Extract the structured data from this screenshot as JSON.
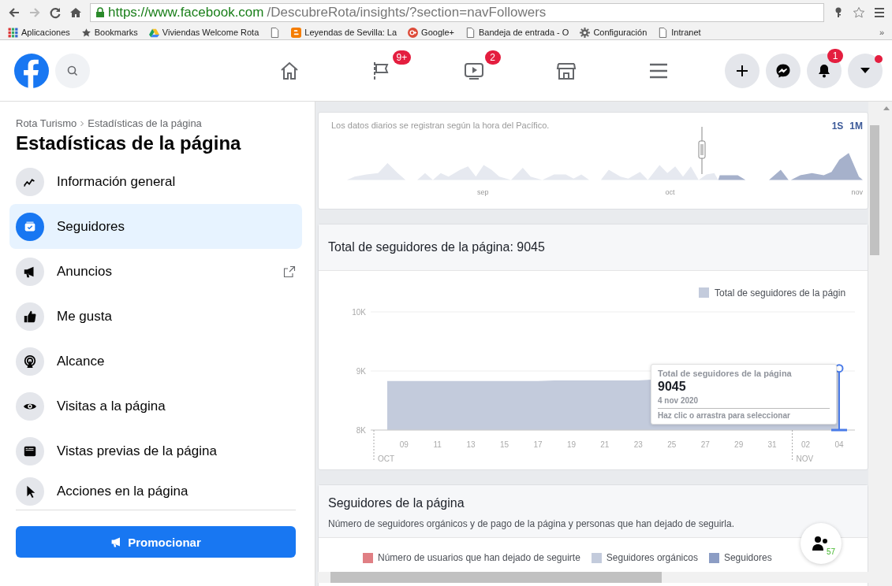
{
  "browser": {
    "url_host": "https://www.facebook.com",
    "url_path": "/DescubreRota/insights/?section=navFollowers",
    "bookmarks": [
      {
        "kind": "apps",
        "label": "Aplicaciones"
      },
      {
        "kind": "star",
        "label": "Bookmarks"
      },
      {
        "kind": "drive",
        "label": "Viviendas Welcome Rota"
      },
      {
        "kind": "page"
      },
      {
        "kind": "blogger",
        "label": "Leyendas de Sevilla: La"
      },
      {
        "kind": "google",
        "label": "Google+"
      },
      {
        "kind": "page",
        "label": "Bandeja de entrada - O"
      },
      {
        "kind": "gear",
        "label": "Configuración"
      },
      {
        "kind": "page",
        "label": "Intranet"
      }
    ],
    "more": "»"
  },
  "nav": {
    "tabs": [
      {
        "kind": "home"
      },
      {
        "kind": "flag",
        "badge": "9+"
      },
      {
        "kind": "video",
        "badge": "2"
      },
      {
        "kind": "store"
      },
      {
        "kind": "menu"
      }
    ],
    "actions": [
      {
        "kind": "plus"
      },
      {
        "kind": "messenger"
      },
      {
        "kind": "bell",
        "badge": "1"
      },
      {
        "kind": "caret",
        "alert": true
      }
    ]
  },
  "sidebar": {
    "breadcrumb": [
      "Rota Turismo",
      "Estadísticas de la página"
    ],
    "title": "Estadísticas de la página",
    "items": [
      {
        "kind": "trend",
        "label": "Información general",
        "selected": false
      },
      {
        "kind": "followers",
        "label": "Seguidores",
        "selected": true
      },
      {
        "kind": "megaphone",
        "label": "Anuncios",
        "selected": false,
        "external": true
      },
      {
        "kind": "like",
        "label": "Me gusta",
        "selected": false
      },
      {
        "kind": "reach",
        "label": "Alcance",
        "selected": false
      },
      {
        "kind": "eye",
        "label": "Visitas a la página",
        "selected": false
      },
      {
        "kind": "preview",
        "label": "Vistas previas de la página",
        "selected": false
      },
      {
        "kind": "pointer",
        "label": "Acciones en la página",
        "selected": false
      }
    ],
    "promote_button": "Promocionar"
  },
  "overview": {
    "note": "Los datos diarios se registran según la hora del Pacífico.",
    "ranges": [
      "1S",
      "1M"
    ],
    "months": [
      "sep",
      "oct",
      "nov"
    ]
  },
  "followers": {
    "title": "Total de seguidores de la página: 9045",
    "chart_data": {
      "type": "area",
      "categories": [
        null,
        "09",
        null,
        "11",
        null,
        "13",
        null,
        "15",
        null,
        "17",
        null,
        "19",
        null,
        "21",
        null,
        "23",
        null,
        "25",
        null,
        "27",
        null,
        "29",
        null,
        "31",
        null,
        "02",
        null,
        "04"
      ],
      "series": [
        {
          "name": "Total de seguidores de la págin",
          "color": "#c3cbdc",
          "values": [
            8830,
            8830,
            8830,
            8830,
            8830,
            8830,
            8830,
            8830,
            8830,
            8830,
            8840,
            8840,
            8840,
            8840,
            8840,
            8840,
            null,
            null,
            null,
            null,
            null,
            null,
            null,
            null,
            null,
            null,
            null,
            9045
          ]
        }
      ],
      "ylim": [
        8000,
        10000
      ],
      "yticks": [
        {
          "value": 8000,
          "label": "8K"
        },
        {
          "value": 9000,
          "label": "9K"
        },
        {
          "value": 10000,
          "label": "10K"
        }
      ]
    },
    "axis_months": [
      "OCT",
      "NOV"
    ],
    "tooltip": {
      "title": "Total de seguidores de la página",
      "value": "9045",
      "date": "4 nov 2020",
      "hint": "Haz clic o arrastra para seleccionar"
    }
  },
  "breakdown": {
    "title": "Seguidores de la página",
    "subtitle": "Número de seguidores orgánicos y de pago de la página y personas que han dejado de seguirla.",
    "legend": [
      {
        "label": "Número de usuarios que han dejado de seguirte",
        "color": "#e07f84"
      },
      {
        "label": "Seguidores orgánicos",
        "color": "#c3cbdc"
      },
      {
        "label": "Seguidores",
        "color": "#8c9dc4"
      }
    ]
  },
  "chat_button": {
    "count": "57"
  }
}
